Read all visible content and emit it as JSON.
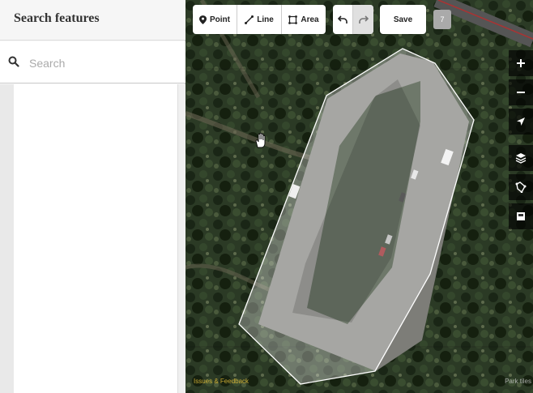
{
  "sidebar": {
    "title": "Search features",
    "search": {
      "placeholder": "Search",
      "value": ""
    }
  },
  "toolbar": {
    "point_label": "Point",
    "line_label": "Line",
    "area_label": "Area",
    "save_label": "Save",
    "edit_count": "7"
  },
  "map": {
    "attribution": "Issues & Feedback",
    "imagery_credit": "Park tiles"
  },
  "colors": {
    "accent": "#e8c23a",
    "toolbar_bg": "#ffffff",
    "control_bg": "rgba(0,0,0,0.65)",
    "area_fill": "rgba(255,255,255,0.35)"
  },
  "icons": {
    "search": "search-icon",
    "point": "pin-icon",
    "line": "line-icon",
    "area": "area-icon",
    "undo": "undo-icon",
    "redo": "redo-icon",
    "zoom_in": "plus-icon",
    "zoom_out": "minus-icon",
    "locate": "location-arrow-icon",
    "layers": "layers-icon",
    "map_data": "map-data-icon",
    "issues": "issues-icon",
    "cursor": "hand-cursor-icon"
  }
}
